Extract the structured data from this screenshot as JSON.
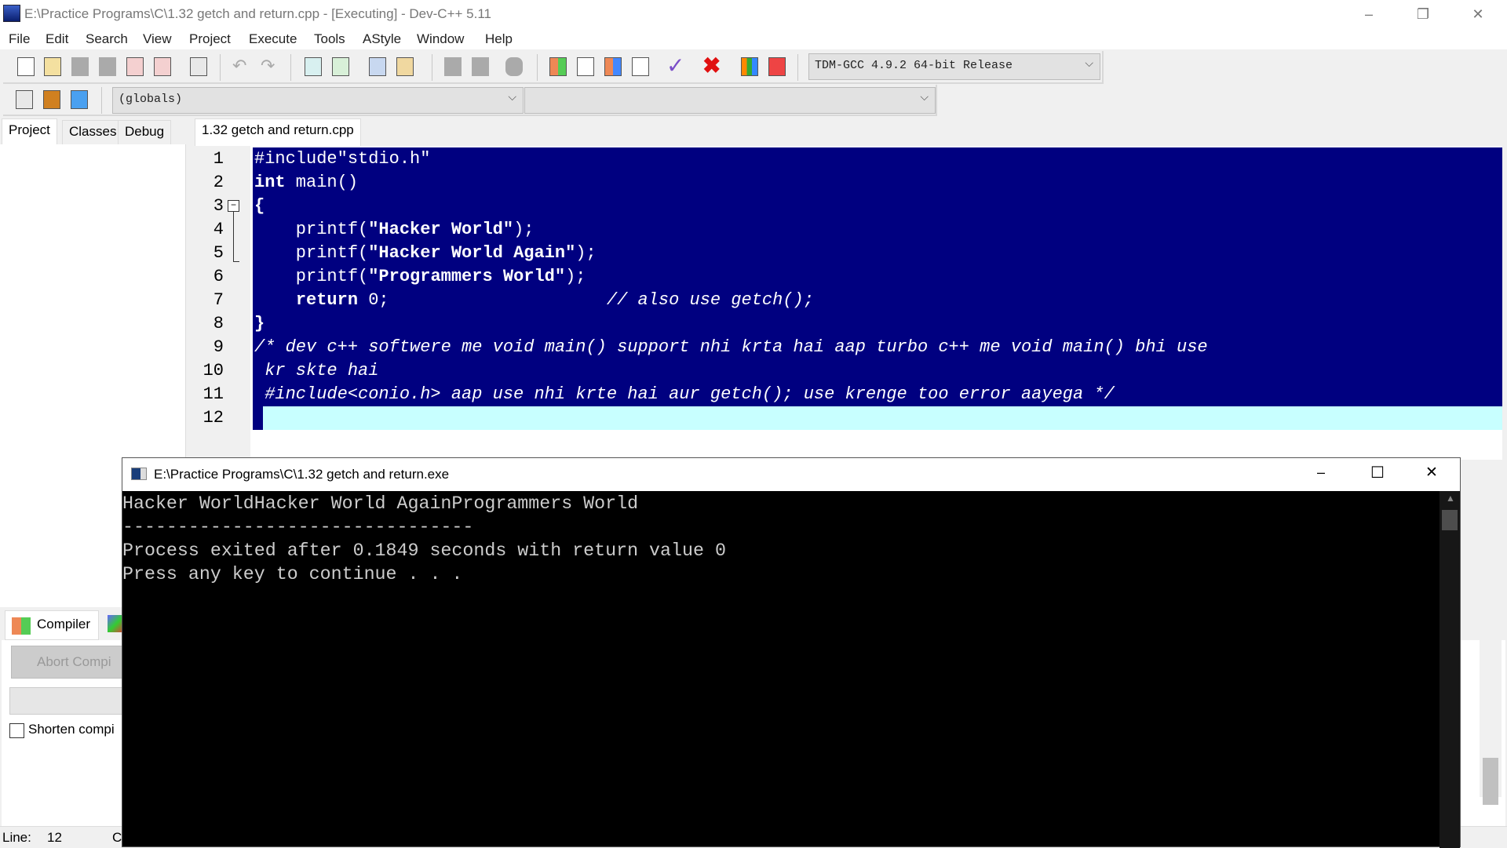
{
  "window": {
    "title": "E:\\Practice Programs\\C\\1.32 getch and return.cpp - [Executing] - Dev-C++ 5.11",
    "minimize": "–",
    "restore": "❐",
    "close": "✕"
  },
  "menu": [
    "File",
    "Edit",
    "Search",
    "View",
    "Project",
    "Execute",
    "Tools",
    "AStyle",
    "Window",
    "Help"
  ],
  "toolbar": {
    "compiler_select": "TDM-GCC 4.9.2 64-bit Release",
    "scope_select": "(globals)",
    "member_select": "",
    "chevron": "⌵"
  },
  "left_tabs": [
    "Project",
    "Classes",
    "Debug"
  ],
  "editor": {
    "tab": "1.32 getch and return.cpp",
    "line_numbers": [
      "1",
      "2",
      "3",
      "4",
      "5",
      "6",
      "7",
      "8",
      "9",
      "10",
      "11",
      "12"
    ],
    "fold_icon": "−",
    "lines": [
      [
        {
          "t": "#include\"stdio.h\"",
          "s": "pp"
        }
      ],
      [
        {
          "t": "int",
          "s": "kw"
        },
        {
          "t": " main()",
          "s": "n"
        }
      ],
      [
        {
          "t": "{",
          "s": "kw"
        }
      ],
      [
        {
          "t": "    printf(",
          "s": "n"
        },
        {
          "t": "\"Hacker World\"",
          "s": "str"
        },
        {
          "t": ");",
          "s": "n"
        }
      ],
      [
        {
          "t": "    printf(",
          "s": "n"
        },
        {
          "t": "\"Hacker World Again\"",
          "s": "str"
        },
        {
          "t": ");",
          "s": "n"
        }
      ],
      [
        {
          "t": "    printf(",
          "s": "n"
        },
        {
          "t": "\"Programmers World\"",
          "s": "str"
        },
        {
          "t": ");",
          "s": "n"
        }
      ],
      [
        {
          "t": "    ",
          "s": "n"
        },
        {
          "t": "return",
          "s": "kw"
        },
        {
          "t": " 0;",
          "s": "n"
        },
        {
          "t": "                     ",
          "s": "n"
        },
        {
          "t": "// also use getch();",
          "s": "cm"
        }
      ],
      [
        {
          "t": "}",
          "s": "kw"
        }
      ],
      [
        {
          "t": "/* dev c++ softwere me void main() support nhi krta hai aap turbo c++ me void main() bhi use",
          "s": "cm"
        }
      ],
      [
        {
          "t": " kr skte hai",
          "s": "cm"
        }
      ],
      [
        {
          "t": " #include<conio.h> aap use nhi krte hai aur getch(); use krenge too error aayega */",
          "s": "cm"
        }
      ],
      []
    ]
  },
  "bottom": {
    "compiler_tab": "Compiler",
    "abort_button": "Abort Compi",
    "shorten_label": "Shorten compi",
    "shorten_checked": false
  },
  "status": {
    "line_label": "Line:",
    "line_value": "12",
    "col_label": "C"
  },
  "console": {
    "title": "E:\\Practice Programs\\C\\1.32 getch and return.exe",
    "minimize": "–",
    "maximize": "☐",
    "close": "✕",
    "lines": [
      "Hacker WorldHacker World AgainProgrammers World",
      "--------------------------------",
      "Process exited after 0.1849 seconds with return value 0",
      "Press any key to continue . . ."
    ]
  },
  "colors": {
    "selection": "#000080",
    "current_line": "#c8ffff",
    "console_bg": "#000000"
  }
}
